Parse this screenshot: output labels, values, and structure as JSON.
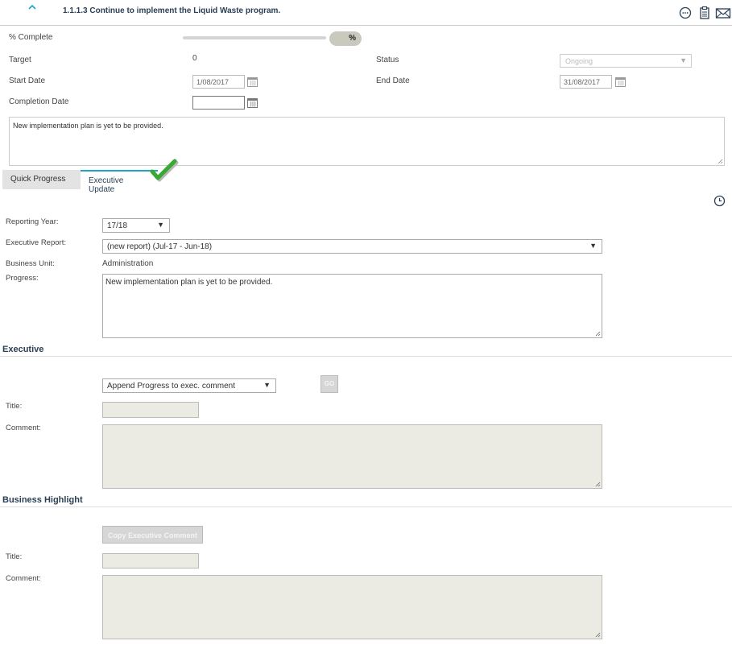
{
  "header": {
    "title": "1.1.1.3 Continue to implement the Liquid Waste program."
  },
  "fields": {
    "pct_label": "% Complete",
    "pct_value": "%",
    "target_label": "Target",
    "target_value": "0",
    "status_label": "Status",
    "status_value": "Ongoing",
    "start_label": "Start Date",
    "start_value": "1/08/2017",
    "end_label": "End Date",
    "end_value": "31/08/2017",
    "completion_label": "Completion Date",
    "completion_value": "",
    "notes": "New implementation plan is yet to be provided."
  },
  "tabs": {
    "quick": "Quick Progress",
    "exec": "Executive Update"
  },
  "exec_update": {
    "year_label": "Reporting Year:",
    "year_value": "17/18",
    "report_label": "Executive Report:",
    "report_value": "(new report) (Jul-17 - Jun-18)",
    "unit_label": "Business Unit:",
    "unit_value": "Administration",
    "progress_label": "Progress:",
    "progress_value": "New implementation plan is yet to be provided."
  },
  "executive": {
    "heading": "Executive",
    "action_value": "Append Progress to exec. comment",
    "go_label": "GO",
    "title_label": "Title:",
    "comment_label": "Comment:"
  },
  "highlight": {
    "heading": "Business Highlight",
    "copy_label": "Copy Executive Comment",
    "title_label": "Title:",
    "comment_label": "Comment:"
  },
  "colors": {
    "accent": "#1fa3c7",
    "heading": "#2a3f55",
    "check": "#3aa832"
  }
}
